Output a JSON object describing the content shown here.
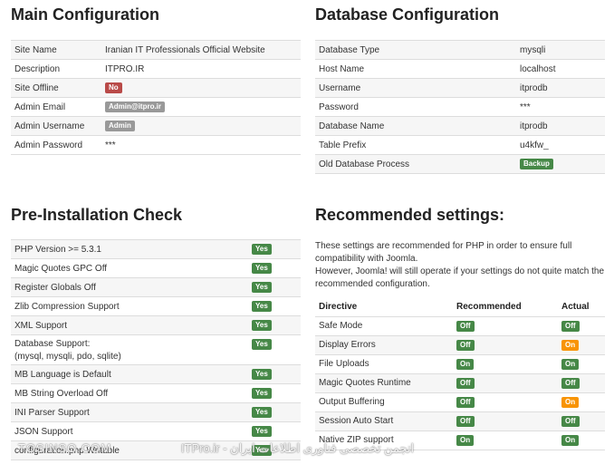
{
  "main_config": {
    "title": "Main Configuration",
    "rows": [
      {
        "label": "Site Name",
        "value": "Iranian IT Professionals Official Website"
      },
      {
        "label": "Description",
        "value": "ITPRO.IR"
      },
      {
        "label": "Site Offline",
        "badge": "No"
      },
      {
        "label": "Admin Email",
        "badge": "Admin@itpro.ir"
      },
      {
        "label": "Admin Username",
        "badge": "Admin"
      },
      {
        "label": "Admin Password",
        "value": "***"
      }
    ]
  },
  "db_config": {
    "title": "Database Configuration",
    "rows": [
      {
        "label": "Database Type",
        "value": "mysqli"
      },
      {
        "label": "Host Name",
        "value": "localhost"
      },
      {
        "label": "Username",
        "value": "itprodb"
      },
      {
        "label": "Password",
        "value": "***"
      },
      {
        "label": "Database Name",
        "value": "itprodb"
      },
      {
        "label": "Table Prefix",
        "value": "u4kfw_"
      },
      {
        "label": "Old Database Process",
        "badge": "Backup"
      }
    ]
  },
  "pre_install": {
    "title": "Pre-Installation Check",
    "rows": [
      {
        "label": "PHP Version >= 5.3.1",
        "badge": "Yes"
      },
      {
        "label": "Magic Quotes GPC Off",
        "badge": "Yes"
      },
      {
        "label": "Register Globals Off",
        "badge": "Yes"
      },
      {
        "label": "Zlib Compression Support",
        "badge": "Yes"
      },
      {
        "label": "XML Support",
        "badge": "Yes"
      },
      {
        "label": "Database Support:",
        "label2": "(mysql, mysqli, pdo, sqlite)",
        "badge": "Yes"
      },
      {
        "label": "MB Language is Default",
        "badge": "Yes"
      },
      {
        "label": "MB String Overload Off",
        "badge": "Yes"
      },
      {
        "label": "INI Parser Support",
        "badge": "Yes"
      },
      {
        "label": "JSON Support",
        "badge": "Yes"
      },
      {
        "label": "configuration.php Writable",
        "badge": "Yes"
      }
    ]
  },
  "recommended": {
    "title": "Recommended settings:",
    "intro1": "These settings are recommended for PHP in order to ensure full compatibility with Joomla.",
    "intro2": "However, Joomla! will still operate if your settings do not quite match the recommended configuration.",
    "headers": {
      "directive": "Directive",
      "recommended": "Recommended",
      "actual": "Actual"
    },
    "rows": [
      {
        "directive": "Safe Mode",
        "recommended": "Off",
        "actual": "Off",
        "actual_status": "ok"
      },
      {
        "directive": "Display Errors",
        "recommended": "Off",
        "actual": "On",
        "actual_status": "warn"
      },
      {
        "directive": "File Uploads",
        "recommended": "On",
        "actual": "On",
        "actual_status": "ok"
      },
      {
        "directive": "Magic Quotes Runtime",
        "recommended": "Off",
        "actual": "Off",
        "actual_status": "ok"
      },
      {
        "directive": "Output Buffering",
        "recommended": "Off",
        "actual": "On",
        "actual_status": "warn"
      },
      {
        "directive": "Session Auto Start",
        "recommended": "Off",
        "actual": "Off",
        "actual_status": "ok"
      },
      {
        "directive": "Native ZIP support",
        "recommended": "On",
        "actual": "On",
        "actual_status": "ok"
      }
    ]
  },
  "watermark": {
    "left": "TOSINSO.COM",
    "right": "انجمن تخصصی فناوری اطلاعات ایران - ITPro.ir"
  },
  "colors": {
    "success": "#468847",
    "important": "#b94a48",
    "warning": "#f89406",
    "neutral": "#999999"
  }
}
